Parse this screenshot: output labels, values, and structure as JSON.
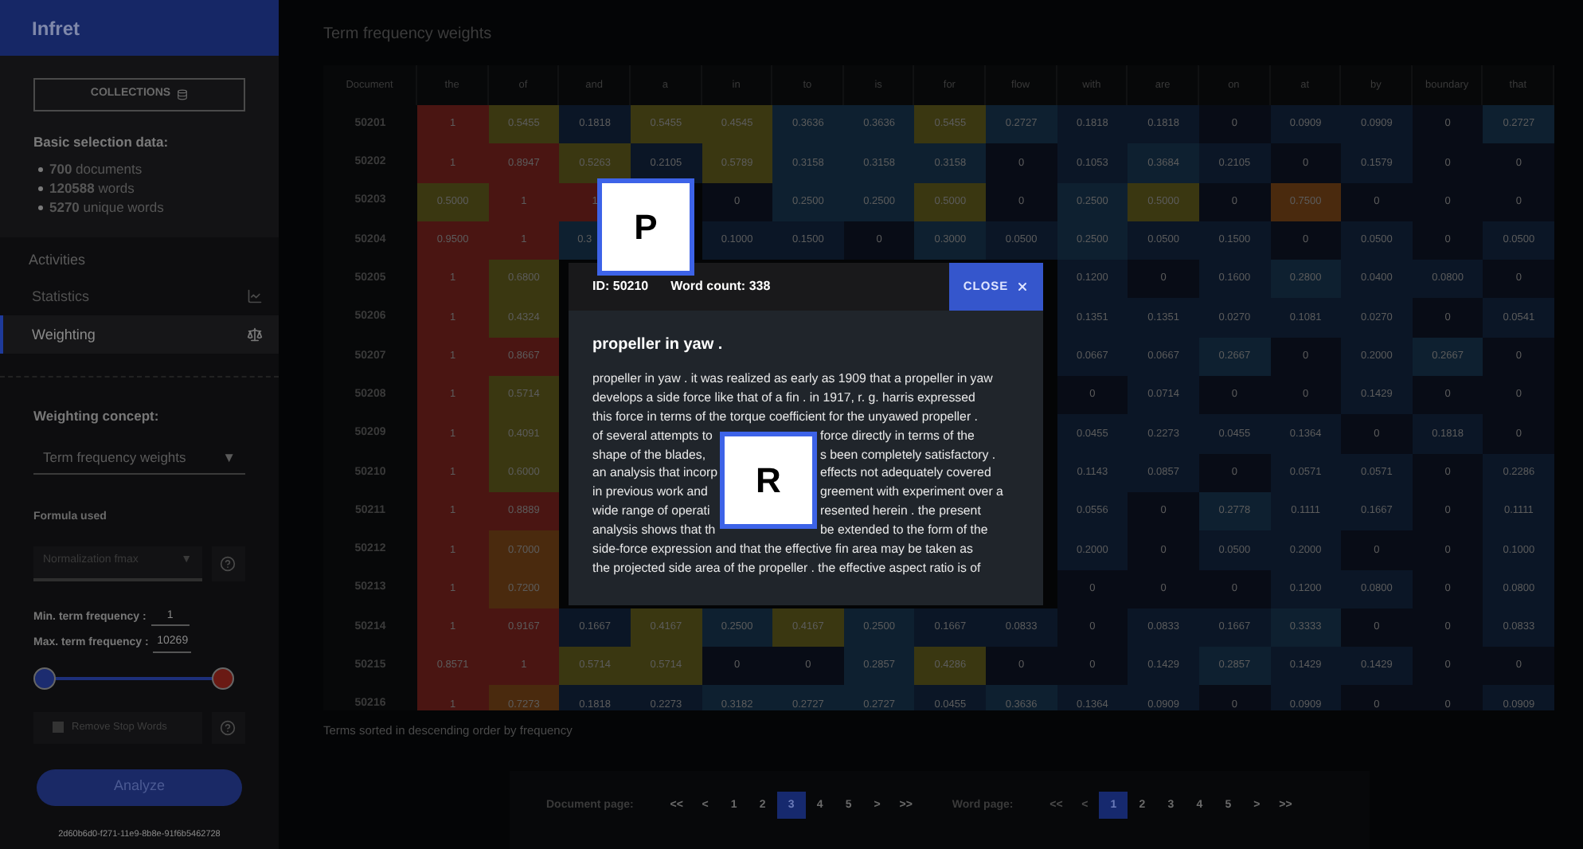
{
  "app_title": "Infret",
  "sidebar": {
    "collections_button": "COLLECTIONS",
    "selection_heading": "Basic selection data:",
    "selection_stats": [
      "**700** documents",
      "**120588** words",
      "**5270** unique words"
    ],
    "activities_heading": "Activities",
    "activities": [
      {
        "label": "Statistics",
        "selected": false
      },
      {
        "label": "Weighting",
        "selected": true
      }
    ],
    "weighting_concept": {
      "label": "Weighting concept:",
      "value": "Term frequency weights",
      "caret": "▼"
    },
    "formula": {
      "label": "Formula used",
      "value": "Normalization fmax",
      "caret": "▼",
      "disabled": true
    },
    "min_term_frequency": {
      "label": "Min. term frequency :",
      "value": "1"
    },
    "max_term_frequency": {
      "label": "Max. term frequency :",
      "value": "10269"
    },
    "range_slider": {
      "thumbs": [
        {
          "level": 0
        },
        {
          "level": 1
        }
      ]
    },
    "remove_stop_words": {
      "label": "Remove Stop Words",
      "checked": false,
      "disabled": true
    },
    "analyze_button": "Analyze",
    "session_id": "2d60b6d0-f271-11e9-8b8e-91f6b5462728"
  },
  "main": {
    "title": "Term frequency weights",
    "table": {
      "columns": [
        "Document",
        "the",
        "of",
        "and",
        "a",
        "in",
        "to",
        "is",
        "for",
        "flow",
        "with",
        "are",
        "on",
        "at",
        "by",
        "boundary",
        "that"
      ],
      "rows": [
        {
          "cells": [
            "50201",
            "1",
            "0.5455",
            "0.1818",
            "0.5455",
            "0.4545",
            "0.3636",
            "0.3636",
            "0.5455",
            "0.2727",
            "0.1818",
            "0.1818",
            "0",
            "0.0909",
            "0.0909",
            "0",
            "0.2727"
          ]
        },
        {
          "cells": [
            "50202",
            "1",
            "0.8947",
            "0.5263",
            "0.2105",
            "0.5789",
            "0.3158",
            "0.3158",
            "0.3158",
            "0",
            "0.1053",
            "0.3684",
            "0.2105",
            "0",
            "0.1579",
            "0",
            "0"
          ]
        },
        {
          "cells": [
            "50203",
            "0.5000",
            "1",
            "1",
            null,
            "0",
            "0.2500",
            "0.2500",
            "0.5000",
            "0",
            "0.2500",
            "0.5000",
            "0",
            "0.7500",
            "0",
            "0",
            "0"
          ]
        },
        {
          "cells": [
            "50204",
            "0.9500",
            "1",
            "0.3",
            null,
            "0.1000",
            "0.1500",
            "0",
            "0.3000",
            "0.0500",
            "0.2500",
            "0.0500",
            "0.1500",
            "0",
            "0.0500",
            "0",
            "0.0500"
          ]
        },
        {
          "cells": [
            "50205",
            "1",
            "0.6800",
            null,
            null,
            null,
            null,
            null,
            null,
            null,
            "0.1200",
            "0",
            "0.1600",
            "0.2800",
            "0.0400",
            "0.0800",
            "0"
          ]
        },
        {
          "cells": [
            "50206",
            "1",
            "0.4324",
            null,
            null,
            null,
            null,
            null,
            null,
            null,
            "0.1351",
            "0.1351",
            "0.0270",
            "0.1081",
            "0.0270",
            "0",
            "0.0541"
          ]
        },
        {
          "cells": [
            "50207",
            "1",
            "0.8667",
            null,
            null,
            null,
            null,
            null,
            null,
            null,
            "0.0667",
            "0.0667",
            "0.2667",
            "0",
            "0.2000",
            "0.2667",
            "0"
          ]
        },
        {
          "cells": [
            "50208",
            "1",
            "0.5714",
            null,
            null,
            null,
            null,
            null,
            null,
            null,
            "0",
            "0.0714",
            "0",
            "0",
            "0.1429",
            "0",
            "0"
          ]
        },
        {
          "cells": [
            "50209",
            "1",
            "0.4091",
            null,
            null,
            null,
            null,
            null,
            null,
            null,
            "0.0455",
            "0.2273",
            "0.0455",
            "0.1364",
            "0",
            "0.1818",
            "0"
          ]
        },
        {
          "cells": [
            "50210",
            "1",
            "0.6000",
            null,
            null,
            null,
            null,
            null,
            null,
            null,
            "0.1143",
            "0.0857",
            "0",
            "0.0571",
            "0.0571",
            "0",
            "0.2286"
          ]
        },
        {
          "cells": [
            "50211",
            "1",
            "0.8889",
            null,
            null,
            null,
            null,
            null,
            null,
            null,
            "0.0556",
            "0",
            "0.2778",
            "0.1111",
            "0.1667",
            "0",
            "0.1111"
          ]
        },
        {
          "cells": [
            "50212",
            "1",
            "0.7000",
            null,
            null,
            null,
            null,
            null,
            null,
            null,
            "0.2000",
            "0",
            "0.0500",
            "0.2000",
            "0",
            "0",
            "0.1000"
          ]
        },
        {
          "cells": [
            "50213",
            "1",
            "0.7200",
            null,
            null,
            null,
            null,
            null,
            null,
            null,
            "0",
            "0",
            "0",
            "0.1200",
            "0.0800",
            "0",
            "0.0800"
          ]
        },
        {
          "cells": [
            "50214",
            "1",
            "0.9167",
            "0.1667",
            "0.4167",
            "0.2500",
            "0.4167",
            "0.2500",
            "0.1667",
            "0.0833",
            "0",
            "0.0833",
            "0.1667",
            "0.3333",
            "0",
            "0",
            "0.0833"
          ]
        },
        {
          "cells": [
            "50215",
            "0.8571",
            "1",
            "0.5714",
            "0.5714",
            "0",
            "0",
            "0.2857",
            "0.4286",
            "0",
            "0",
            "0.1429",
            "0.2857",
            "0.1429",
            "0.1429",
            "0",
            "0"
          ]
        },
        {
          "cells": [
            "50216",
            "1",
            "0.7273",
            "0.1818",
            "0.2273",
            "0.3182",
            "0.2727",
            "0.2727",
            "0.0455",
            "0.3636",
            "0.1364",
            "0.0909",
            "0",
            "0.0909",
            "0",
            "0",
            "0.0909"
          ]
        }
      ]
    },
    "footnote": "Terms sorted in descending order by frequency",
    "pagers": [
      {
        "label": "Document page:",
        "buttons": [
          {
            "label": "<<",
            "selected": false,
            "disabled": false
          },
          {
            "label": "<",
            "selected": false,
            "disabled": false
          },
          {
            "label": "1",
            "selected": false,
            "disabled": false
          },
          {
            "label": "2",
            "selected": false,
            "disabled": false
          },
          {
            "label": "3",
            "selected": true,
            "disabled": false
          },
          {
            "label": "4",
            "selected": false,
            "disabled": false
          },
          {
            "label": "5",
            "selected": false,
            "disabled": false
          },
          {
            "label": ">",
            "selected": false,
            "disabled": false
          },
          {
            "label": ">>",
            "selected": false,
            "disabled": false
          }
        ]
      },
      {
        "label": "Word page:",
        "buttons": [
          {
            "label": "<<",
            "selected": false,
            "disabled": true
          },
          {
            "label": "<",
            "selected": false,
            "disabled": true
          },
          {
            "label": "1",
            "selected": true,
            "disabled": false
          },
          {
            "label": "2",
            "selected": false,
            "disabled": false
          },
          {
            "label": "3",
            "selected": false,
            "disabled": false
          },
          {
            "label": "4",
            "selected": false,
            "disabled": false
          },
          {
            "label": "5",
            "selected": false,
            "disabled": false
          },
          {
            "label": ">",
            "selected": false,
            "disabled": false
          },
          {
            "label": ">>",
            "selected": false,
            "disabled": false
          }
        ]
      }
    ]
  },
  "modal": {
    "id": "ID: 50210",
    "word_count": "Word count: 338",
    "close_button": "CLOSE",
    "title": "propeller in yaw .",
    "abstract_lines": [
      {
        "segments": [
          "propeller in yaw . it was realized as early as 1909 that a propeller in yaw"
        ]
      },
      {
        "segments": [
          "develops a side force like that of a fin . in 1917, r. g. harris expressed"
        ]
      },
      {
        "segments": [
          "this force in terms of the torque coefficient for the unyawed propeller ."
        ]
      },
      {
        "segments": [
          "of several attempts to",
          "force directly in terms of the"
        ]
      },
      {
        "segments": [
          "shape of the blades,",
          "s been completely satisfactory ."
        ]
      },
      {
        "segments": [
          "an analysis that incorp",
          "effects not adequately covered"
        ]
      },
      {
        "segments": [
          "in previous work and",
          "greement with experiment over a"
        ]
      },
      {
        "segments": [
          "wide range of operati",
          "resented herein . the present"
        ]
      },
      {
        "segments": [
          "analysis shows that th",
          "be extended to the form of the"
        ]
      },
      {
        "segments": [
          "side-force expression and that the effective fin area may be taken as"
        ]
      },
      {
        "segments": [
          "the projected side area of the propeller . the effective aspect ratio is of"
        ]
      }
    ]
  },
  "markers": [
    {
      "letter": "P"
    },
    {
      "letter": "R"
    }
  ]
}
